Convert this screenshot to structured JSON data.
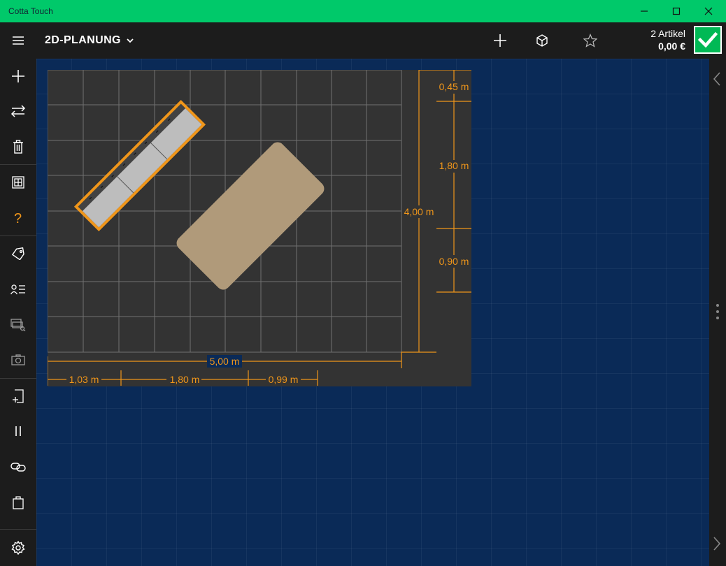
{
  "window": {
    "title": "Cotta Touch"
  },
  "header": {
    "mode": "2D-PLANUNG",
    "cart_count": "2 Artikel",
    "cart_total": "0,00 €"
  },
  "plan": {
    "dimensions": {
      "width_total": "5,00 m",
      "height_total": "4,00 m",
      "bottom_seg1": "1,03 m",
      "bottom_seg2": "1,80 m",
      "bottom_seg3": "0,99 m",
      "right_seg1": "0,45 m",
      "right_seg2": "1,80 m",
      "right_seg3": "0,90 m"
    }
  },
  "colors": {
    "accent": "#f0961a",
    "confirm": "#00b955",
    "titlebar": "#00c96a",
    "table": "#b09a7a",
    "sofa": "#bdbdbd"
  }
}
